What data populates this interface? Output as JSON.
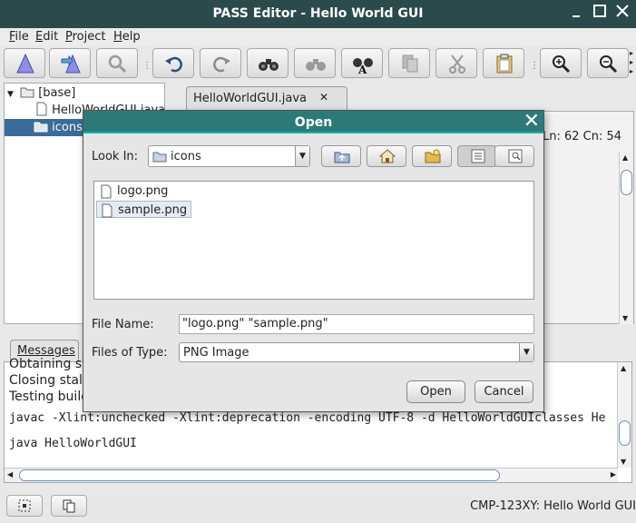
{
  "window": {
    "title": "PASS Editor - Hello World GUI"
  },
  "menu": {
    "items": [
      {
        "label": "File",
        "mnemonic": "F",
        "rest": "ile"
      },
      {
        "label": "Edit",
        "mnemonic": "E",
        "rest": "dit"
      },
      {
        "label": "Project",
        "mnemonic": "P",
        "rest": "roject"
      },
      {
        "label": "Help",
        "mnemonic": "H",
        "rest": "elp"
      }
    ]
  },
  "tree": {
    "root": "[base]",
    "items": [
      "HelloWorldGUI.java",
      "icons"
    ]
  },
  "editor": {
    "tab_label": "HelloWorldGUI.java",
    "tab_close": "✕",
    "cursor_position": "Ln: 62 Cn: 54"
  },
  "messages": {
    "tab_label": "Messages",
    "lines": [
      "Obtaining source files",
      "Closing stale files",
      "Testing build",
      "javac -Xlint:unchecked -Xlint:deprecation -encoding UTF-8 -d HelloWorldGUIclasses He",
      "java HelloWorldGUI"
    ]
  },
  "status": {
    "text": "CMP-123XY: Hello World GUI"
  },
  "dialog": {
    "title": "Open",
    "close_glyph": "✕",
    "look_in_label": "Look In:",
    "look_in_mnemonic": "I",
    "look_in_value": "icons",
    "files": [
      "logo.png",
      "sample.png"
    ],
    "file_name_label": "File Name:",
    "file_name_mnemonic": "N",
    "file_name_value": "\"logo.png\" \"sample.png\"",
    "file_type_label": "Files of Type:",
    "file_type_mnemonic": "T",
    "file_type_value": "PNG Image",
    "open_button": "Open",
    "cancel_button": "Cancel"
  },
  "colors": {
    "title_bar": "#2b4a4c",
    "dialog_title": "#2b7a78",
    "tree_selection": "#3b6b98"
  }
}
